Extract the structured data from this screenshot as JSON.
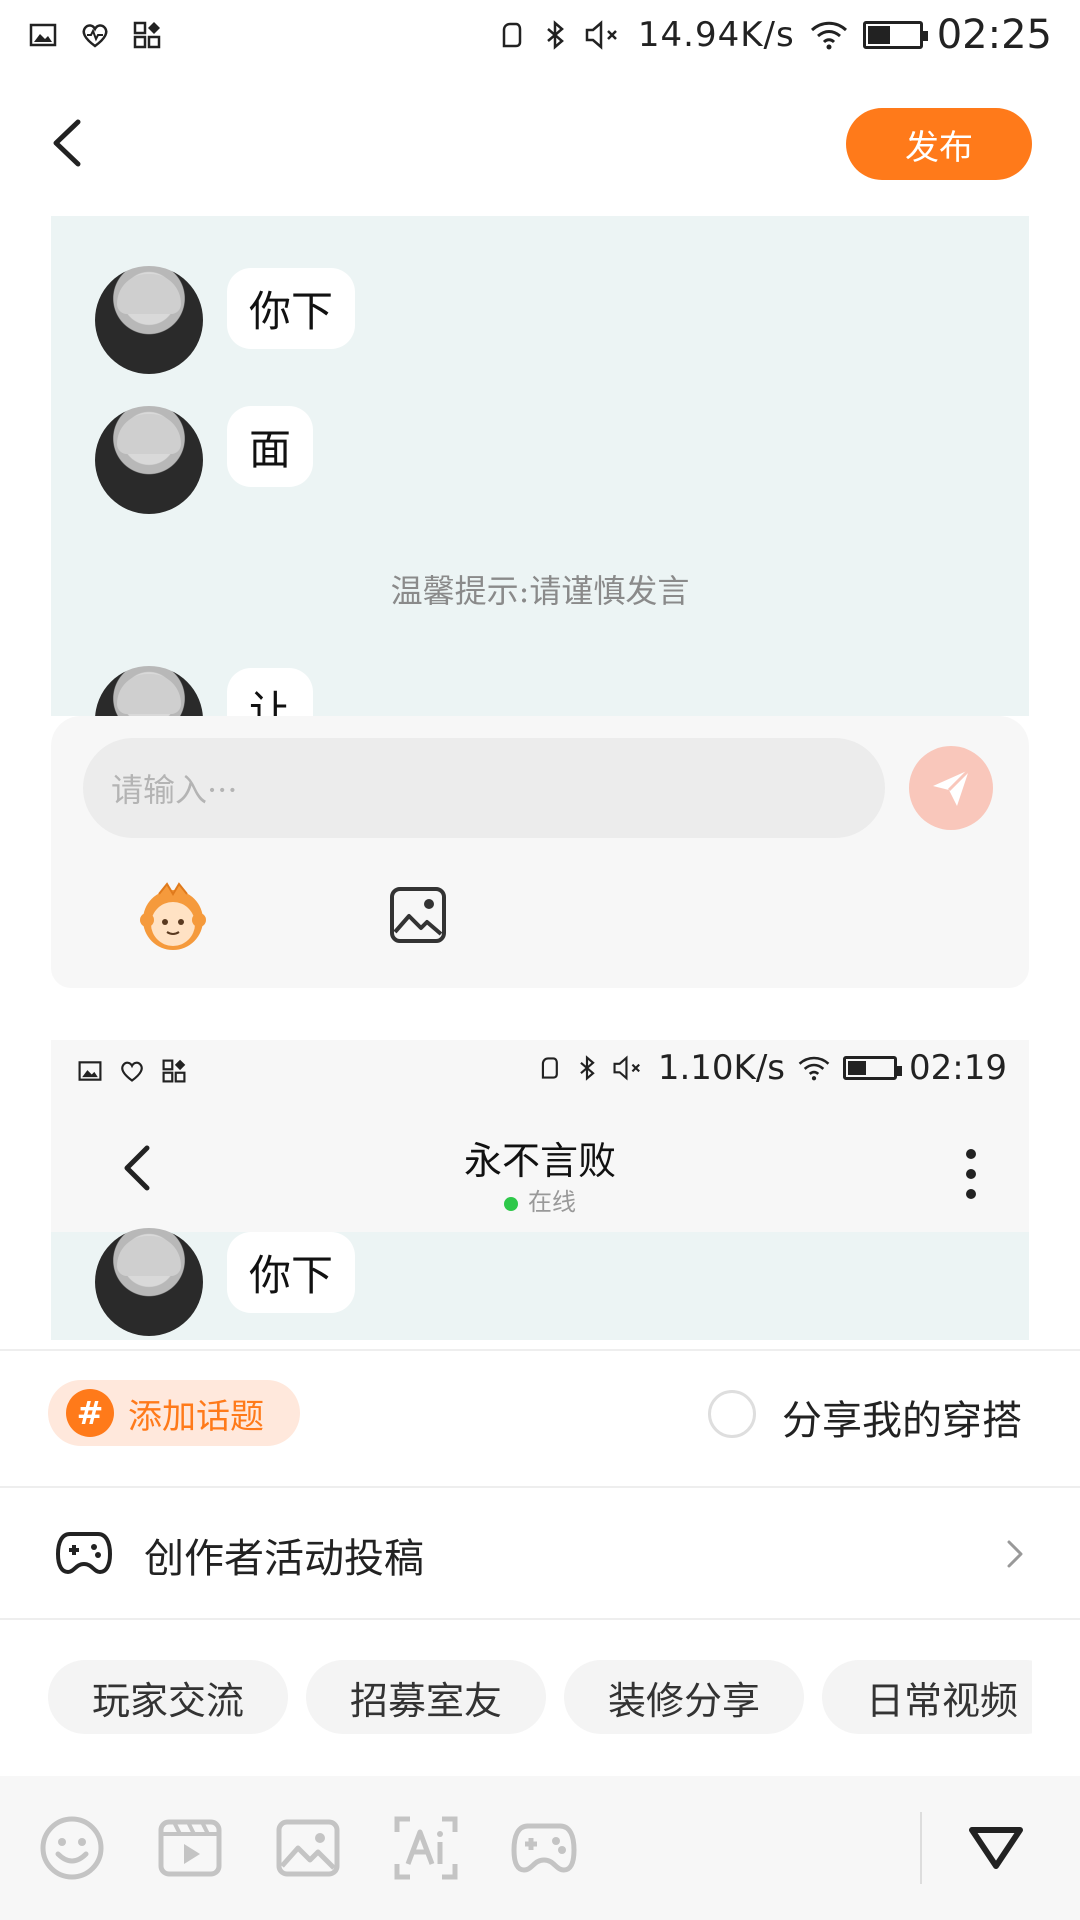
{
  "status_bar": {
    "net_speed": "14.94K/s",
    "time": "02:25"
  },
  "header": {
    "back_icon": "chevron-left-icon",
    "publish_label": "发布"
  },
  "attached_screenshot_1": {
    "messages": [
      "你下",
      "面",
      "让"
    ],
    "hint": "温馨提示:请谨慎发言",
    "input_placeholder": "请输入···",
    "send_icon": "paper-plane-icon",
    "emoji_icon": "mascot-emoji-icon",
    "image_icon": "image-icon"
  },
  "attached_screenshot_2": {
    "net_speed": "1.10K/s",
    "time": "02:19",
    "chat_title": "永不言败",
    "status": "在线",
    "message": "你下"
  },
  "topic": {
    "add_topic_label": "添加话题",
    "share_outfit_label": "分享我的穿搭"
  },
  "creator": {
    "label": "创作者活动投稿"
  },
  "tags": [
    "玩家交流",
    "招募室友",
    "装修分享",
    "日常视频"
  ],
  "toolbar": {
    "icons": [
      "emoji-icon",
      "video-icon",
      "image-icon",
      "ai-text-icon",
      "game-controller-icon"
    ],
    "collapse_icon": "triangle-down-icon"
  },
  "colors": {
    "accent": "#ff7a1a",
    "topic_bg": "#ffe8dc",
    "chat_bg": "#ecf4f4",
    "online_dot": "#2ec84a"
  }
}
